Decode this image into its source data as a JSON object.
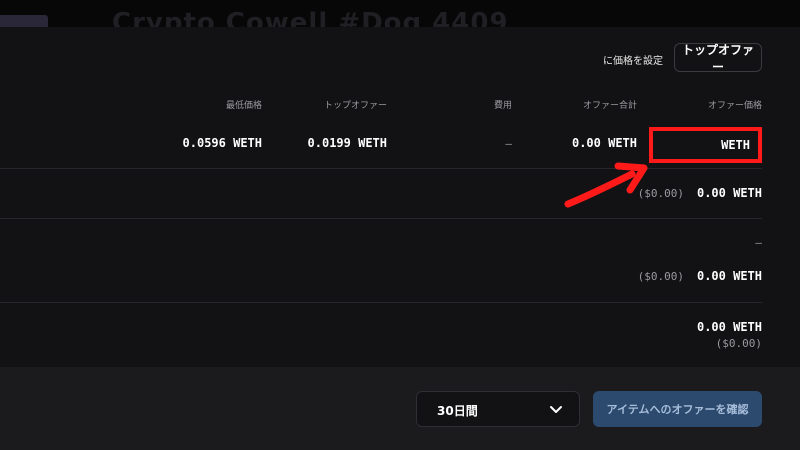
{
  "header": {
    "ghost_title": "Crypto Cowell #Dog 4409"
  },
  "panel": {
    "set_price_label": "に価格を設定",
    "top_offer_button": "トップオファー",
    "columns": {
      "floor_price": "最低価格",
      "top_offer": "トップオファー",
      "fees": "費用",
      "offer_total": "オファー合計",
      "offer_price": "オファー価格"
    },
    "row1": {
      "floor_price": "0.0596 WETH",
      "top_offer": "0.0199 WETH",
      "fees": "—",
      "offer_total": "0.00 WETH",
      "offer_price_unit": "WETH"
    },
    "row2": {
      "usd": "($0.00)",
      "amount": "0.00 WETH"
    },
    "row3": {
      "dash": "—",
      "usd": "($0.00)",
      "amount": "0.00 WETH"
    },
    "row4": {
      "amount": "0.00 WETH",
      "usd": "($0.00)"
    }
  },
  "footer": {
    "duration_value": "30日間",
    "confirm_button": "アイテムへのオファーを確認"
  },
  "colors": {
    "highlight": "#ff1a1a",
    "confirm_bg": "#2b4a6e"
  }
}
